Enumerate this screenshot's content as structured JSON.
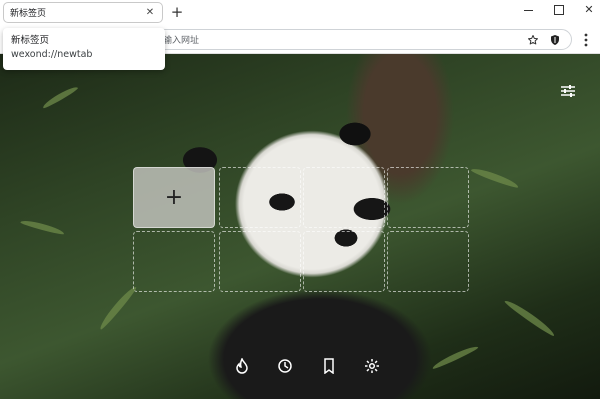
{
  "tab": {
    "title": "新标签页",
    "close_icon": "close-icon"
  },
  "tooltip": {
    "title": "新标签页",
    "url": "wexond://newtab"
  },
  "omnibox": {
    "placeholder_visible": "输入网址"
  },
  "colors": {
    "tab_border": "#c9c9c9",
    "toolbar_bg": "#ffffff",
    "tile_add_bg": "#c8c8c3"
  },
  "icons": {
    "star": "star-icon",
    "shield": "shield-icon",
    "menu": "more-vertical-icon",
    "customize": "sliders-icon",
    "add": "plus-icon",
    "dock": [
      "flame-icon",
      "history-icon",
      "bookmark-icon",
      "gear-icon"
    ]
  },
  "shortcuts": {
    "add_label": "+"
  }
}
